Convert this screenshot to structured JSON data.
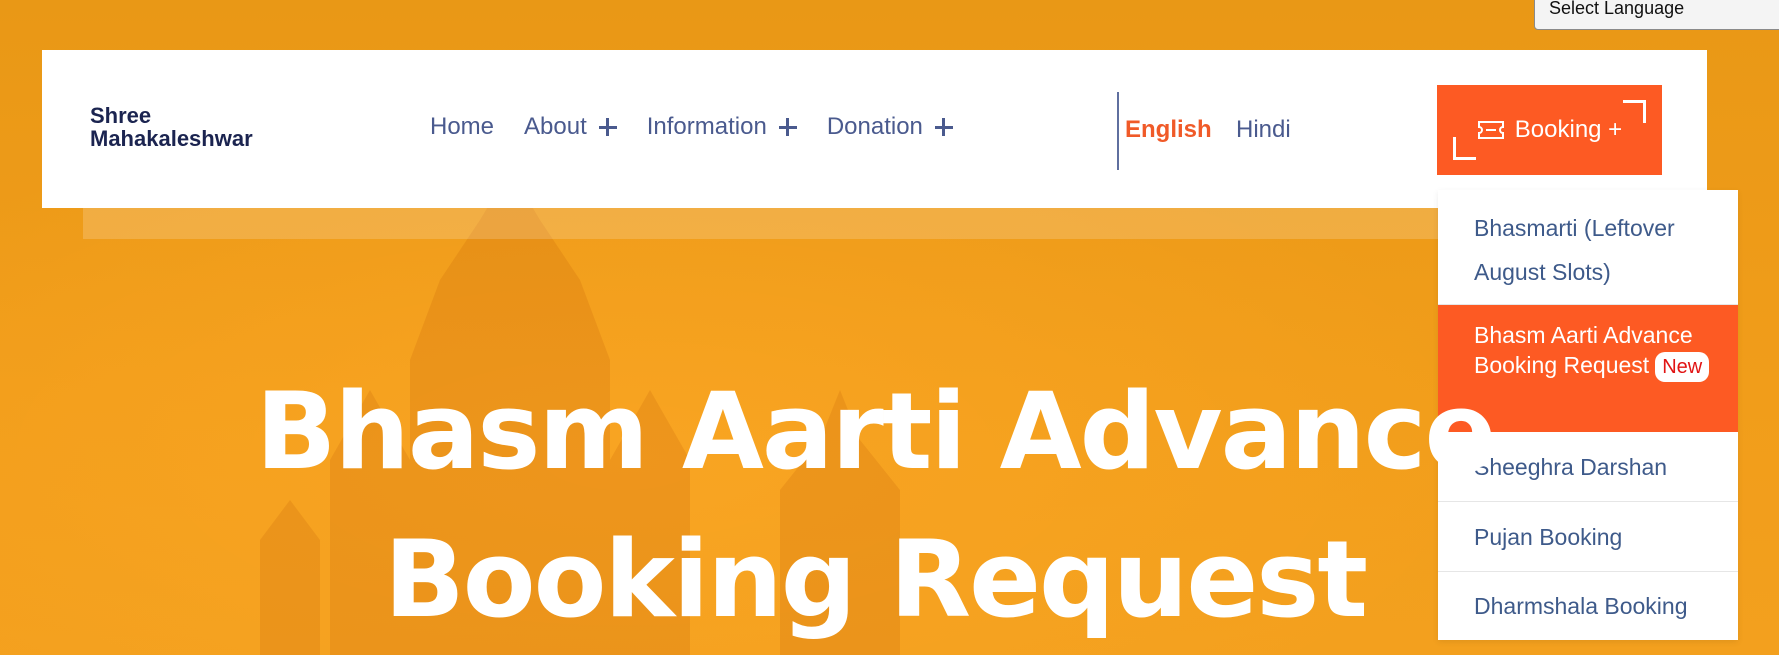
{
  "language_select": {
    "label": "Select Language"
  },
  "logo": {
    "line1": "Shree",
    "line2": "Mahakaleshwar"
  },
  "nav": {
    "items": [
      {
        "label": "Home",
        "has_submenu": false
      },
      {
        "label": "About",
        "has_submenu": true
      },
      {
        "label": "Information",
        "has_submenu": true
      },
      {
        "label": "Donation",
        "has_submenu": true
      }
    ]
  },
  "languages": {
    "english": "English",
    "hindi": "Hindi",
    "active": "English"
  },
  "booking": {
    "label": "Booking +",
    "icon": "ticket-icon"
  },
  "dropdown": {
    "items": [
      {
        "label": "Bhasmarti (Leftover August Slots)",
        "active": false
      },
      {
        "label": "Bhasm Aarti Advance Booking Request",
        "active": true,
        "badge": "New"
      },
      {
        "label": "Sheeghra Darshan",
        "active": false
      },
      {
        "label": "Pujan Booking",
        "active": false
      },
      {
        "label": "Dharmshala Booking",
        "active": false
      }
    ]
  },
  "hero": {
    "title": "Bhasm Aarti Advance Booking Request"
  },
  "colors": {
    "background": "#ec9a1c",
    "accent": "#fd5a23",
    "nav_text": "#4a5a8e",
    "logo_text": "#1b2450",
    "badge_text": "#e11414"
  }
}
